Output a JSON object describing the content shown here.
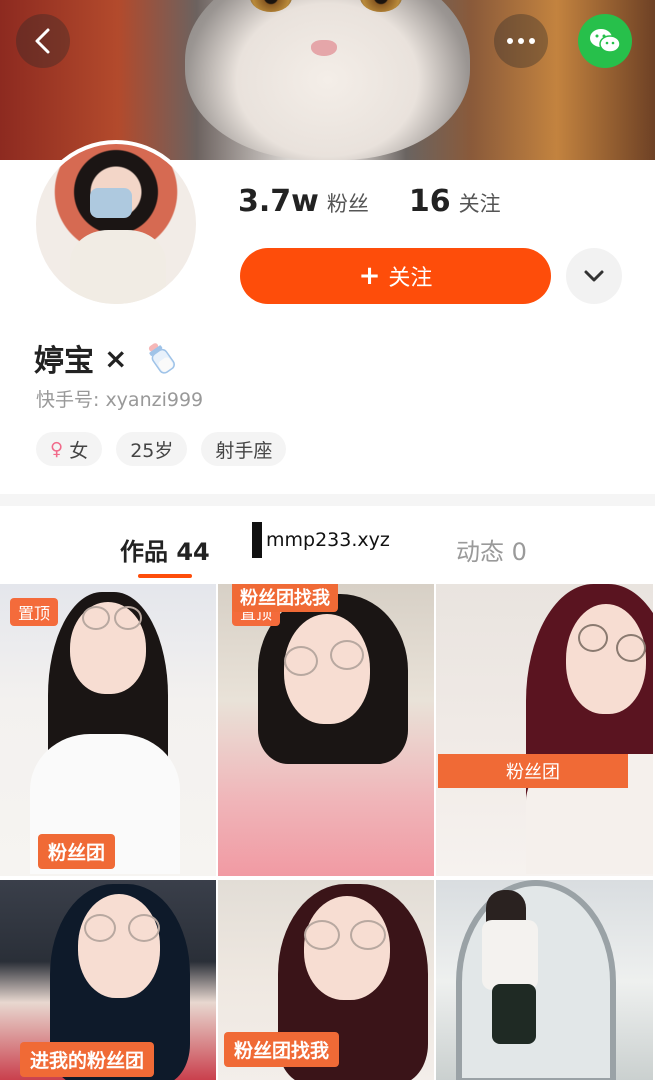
{
  "header": {
    "back_icon": "chevron-left-icon",
    "more_icon": "more-dots-icon",
    "wechat_icon": "wechat-icon",
    "wechat_color": "#27c04b"
  },
  "profile": {
    "followers_count": "3.7w",
    "followers_label": "粉丝",
    "following_count": "16",
    "following_label": "关注",
    "follow_button_label": "关注",
    "follow_button_prefix": "+",
    "accent_color": "#fe4d0a",
    "name": "婷宝",
    "name_suffix": "×",
    "user_id": "快手号: xyanzi999",
    "tags": [
      {
        "label": "女",
        "icon": "female-icon"
      },
      {
        "label": "25岁"
      },
      {
        "label": "射手座"
      }
    ]
  },
  "tabs": {
    "works_label": "作品 44",
    "moments_label": "动态 0"
  },
  "watermark": "mmp233.xyz",
  "grid": [
    {
      "pinned_label": "置顶",
      "label": "粉丝团"
    },
    {
      "pinned_label": "置顶",
      "top_label": "粉丝团找我"
    },
    {
      "band_label": "粉丝团"
    },
    {
      "label": "进我的粉丝团"
    },
    {
      "label": "粉丝团找我"
    },
    {}
  ]
}
